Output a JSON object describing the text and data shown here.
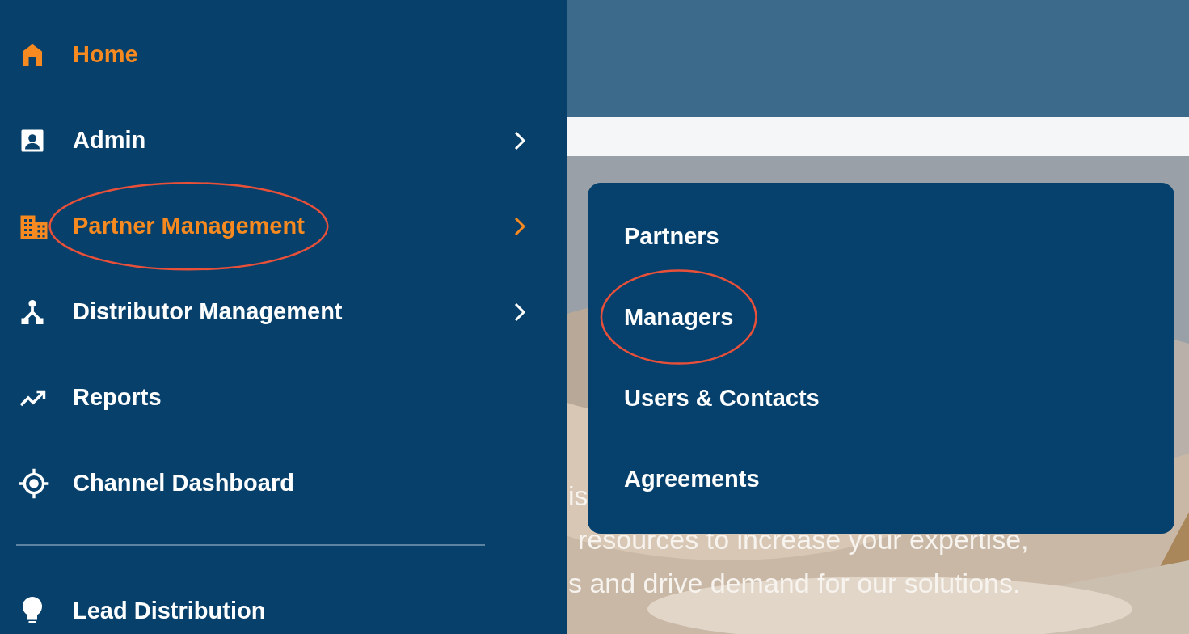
{
  "sidebar": {
    "items": [
      {
        "kind": "home",
        "label": "Home",
        "highlighted": true,
        "submenu": false,
        "circled": false
      },
      {
        "kind": "admin",
        "label": "Admin",
        "highlighted": false,
        "submenu": true,
        "circled": false
      },
      {
        "kind": "building",
        "label": "Partner Management",
        "highlighted": true,
        "submenu": true,
        "circled": true
      },
      {
        "kind": "network",
        "label": "Distributor Management",
        "highlighted": false,
        "submenu": true,
        "circled": false
      },
      {
        "kind": "trend",
        "label": "Reports",
        "highlighted": false,
        "submenu": false,
        "circled": false
      },
      {
        "kind": "target",
        "label": "Channel Dashboard",
        "highlighted": false,
        "submenu": false,
        "circled": false
      },
      {
        "kind": "divider"
      },
      {
        "kind": "bulb",
        "label": "Lead Distribution",
        "highlighted": false,
        "submenu": false,
        "circled": false
      }
    ]
  },
  "submenu": {
    "items": [
      {
        "label": "Partners",
        "circled": false
      },
      {
        "label": "Managers",
        "circled": true
      },
      {
        "label": "Users & Contacts",
        "circled": false
      },
      {
        "label": "Agreements",
        "circled": false
      }
    ]
  },
  "background_text": [
    "is",
    "resources to increase your expertise,",
    "s and drive demand for our solutions."
  ]
}
